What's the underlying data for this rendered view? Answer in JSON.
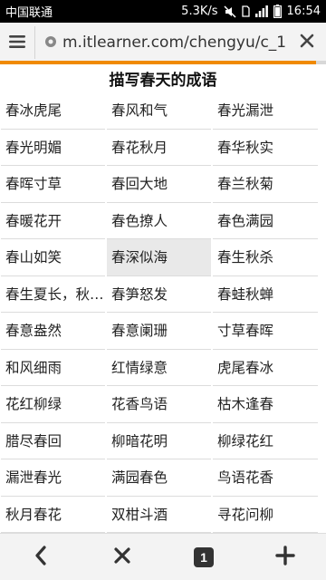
{
  "status_bar": {
    "carrier": "中国联通",
    "speed": "5.3K/s",
    "time": "16:54"
  },
  "browser": {
    "url": "m.itlearner.com/chengyu/c_1",
    "load_progress": 0.97,
    "accent_color": "#f08a00",
    "open_tabs": "1"
  },
  "page": {
    "title": "描写春天的成语",
    "idioms": [
      "春冰虎尾",
      "春风和气",
      "春光漏泄",
      "春光明媚",
      "春花秋月",
      "春华秋实",
      "春晖寸草",
      "春回大地",
      "春兰秋菊",
      "春暖花开",
      "春色撩人",
      "春色满园",
      "春山如笑",
      "春深似海",
      "春生秋杀",
      "春生夏长，秋…",
      "春笋怒发",
      "春蛙秋蝉",
      "春意盎然",
      "春意阑珊",
      "寸草春晖",
      "和风细雨",
      "红情绿意",
      "虎尾春冰",
      "花红柳绿",
      "花香鸟语",
      "枯木逢春",
      "腊尽春回",
      "柳暗花明",
      "柳绿花红",
      "漏泄春光",
      "满园春色",
      "鸟语花香",
      "秋月春花",
      "双柑斗酒",
      "寻花问柳"
    ],
    "highlighted_index": 13
  },
  "icons": {
    "menu": "menu-icon",
    "globe": "globe-icon",
    "close": "close-icon",
    "back": "back-icon",
    "stop": "stop-icon",
    "tabs": "tabs-icon",
    "new_tab": "plus-icon"
  }
}
